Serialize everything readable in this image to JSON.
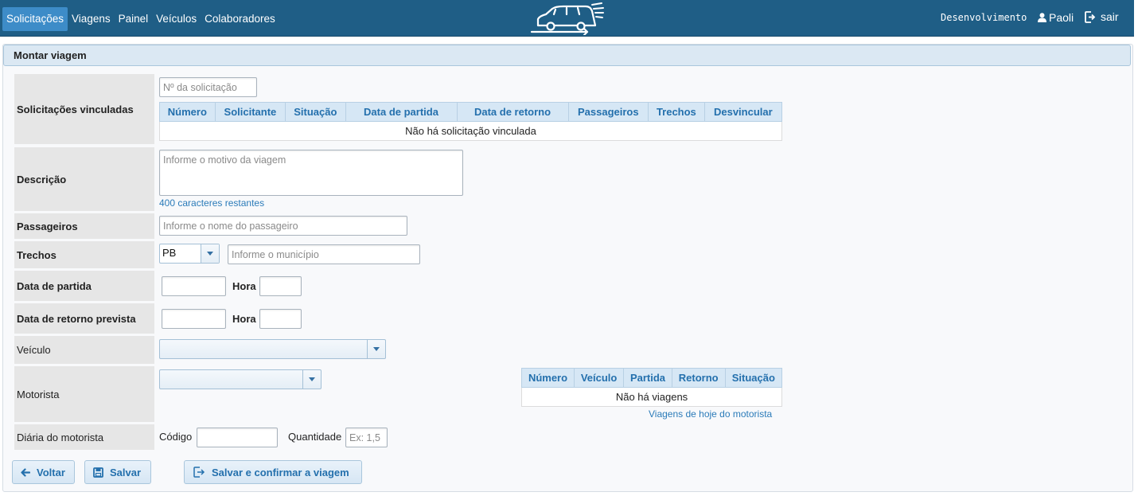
{
  "nav": {
    "items": [
      "Solicitações",
      "Viagens",
      "Painel",
      "Veículos",
      "Colaboradores"
    ],
    "active": "Solicitações"
  },
  "header": {
    "environment": "Desenvolvimento",
    "user": "Paoli",
    "logout": "sair",
    "accent_color": "#1f5e86"
  },
  "panel": {
    "title": "Montar viagem"
  },
  "form": {
    "solicitacoes": {
      "label": "Solicitações vinculadas",
      "search_placeholder": "Nº da solicitação",
      "columns": [
        "Número",
        "Solicitante",
        "Situação",
        "Data de partida",
        "Data de retorno",
        "Passageiros",
        "Trechos",
        "Desvincular"
      ],
      "empty": "Não há solicitação vinculada"
    },
    "descricao": {
      "label": "Descrição",
      "placeholder": "Informe o motivo da viagem",
      "counter": "400 caracteres restantes"
    },
    "passageiros": {
      "label": "Passageiros",
      "placeholder": "Informe o nome do passageiro"
    },
    "trechos": {
      "label": "Trechos",
      "uf": "PB",
      "municipio_placeholder": "Informe o município"
    },
    "partida": {
      "label": "Data de partida",
      "hora_label": "Hora"
    },
    "retorno": {
      "label": "Data de retorno prevista",
      "hora_label": "Hora"
    },
    "veiculo": {
      "label": "Veículo"
    },
    "motorista": {
      "label": "Motorista",
      "columns": [
        "Número",
        "Veículo",
        "Partida",
        "Retorno",
        "Situação"
      ],
      "empty": "Não há viagens",
      "link": "Viagens de hoje do motorista"
    },
    "diaria": {
      "label": "Diária do motorista",
      "codigo_label": "Código",
      "quantidade_label": "Quantidade",
      "quantidade_placeholder": "Ex: 1,5"
    }
  },
  "buttons": {
    "voltar": "Voltar",
    "salvar": "Salvar",
    "salvar_confirmar": "Salvar e confirmar a viagem"
  }
}
